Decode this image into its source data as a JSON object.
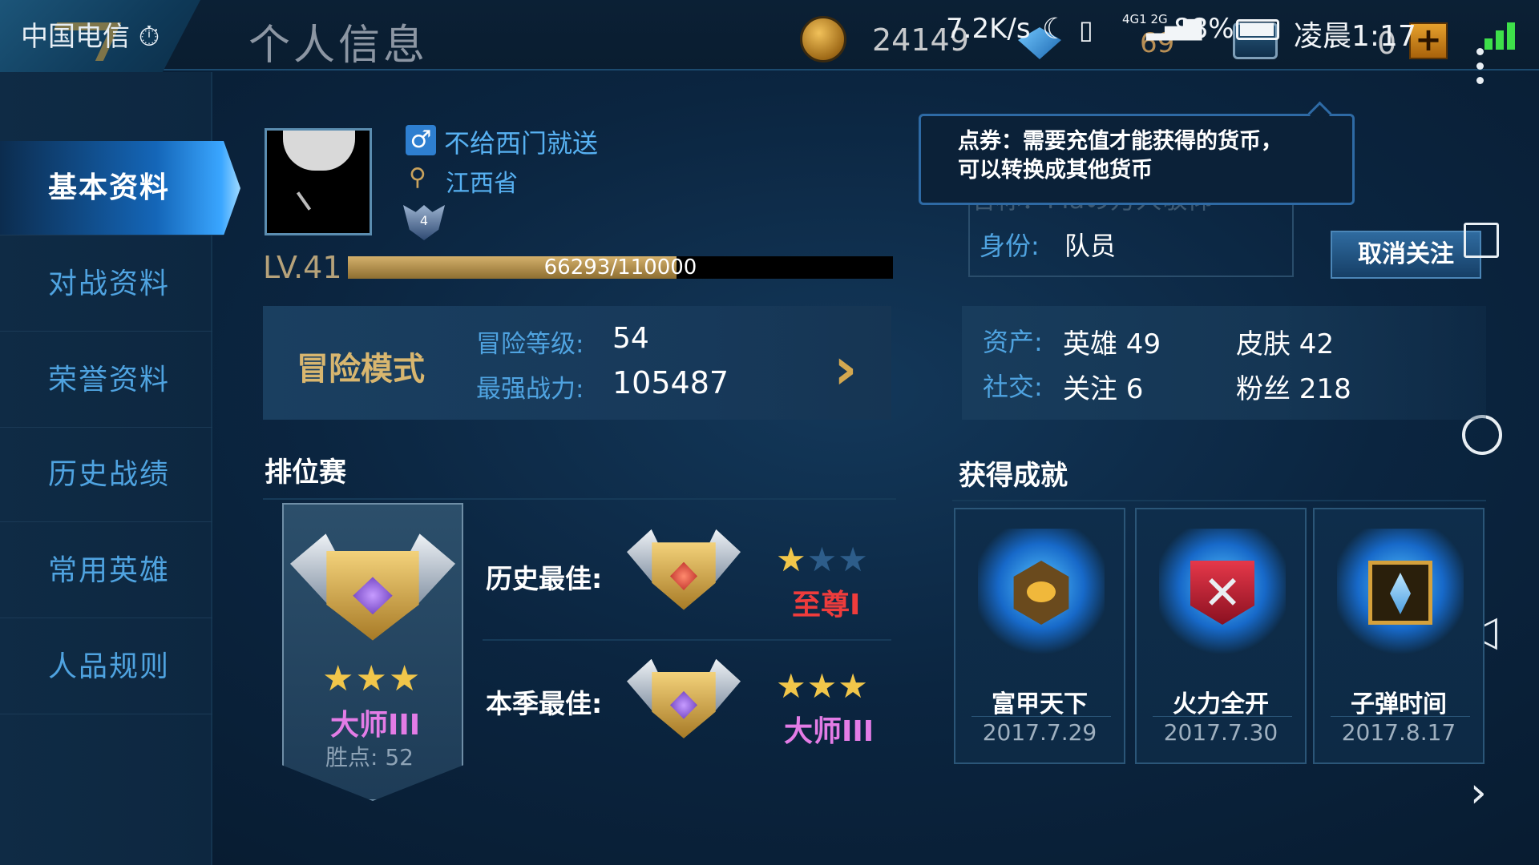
{
  "status_bar": {
    "carrier": "中国电信 ⏱",
    "net_speed": "7.2K/s",
    "net_type": "4G1 2G",
    "battery_pct": "88%",
    "time": "凌晨1:17"
  },
  "header": {
    "title": "个人信息",
    "gold": "24149",
    "diamonds": "69",
    "vouchers": "0",
    "plus": "+"
  },
  "sidebar": {
    "items": [
      {
        "label": "基本资料",
        "active": true
      },
      {
        "label": "对战资料"
      },
      {
        "label": "荣誉资料"
      },
      {
        "label": "历史战绩"
      },
      {
        "label": "常用英雄"
      },
      {
        "label": "人品规则"
      }
    ]
  },
  "profile": {
    "gender_symbol": "♂",
    "name": "不给西门就送",
    "location": "江西省",
    "badge_level": "4",
    "level": "LV.41",
    "xp_text": "66293/110000",
    "xp_fraction": 0.603
  },
  "adventure": {
    "title": "冒险模式",
    "level_label": "冒险等级:",
    "level_value": "54",
    "power_label": "最强战力:",
    "power_value": "105487",
    "arrow": "›"
  },
  "tooltip": {
    "line1": "点券：需要充值才能获得的货币，",
    "line2": "可以转换成其他货币"
  },
  "team": {
    "name_row": "名称：Maの万人敬仰",
    "identity_label": "身份:",
    "identity_value": "队员",
    "unfollow_label": "取消关注"
  },
  "assets": {
    "assets_label": "资产:",
    "heroes": "英雄 49",
    "skins": "皮肤 42",
    "social_label": "社交:",
    "follow": "关注 6",
    "fans": "粉丝 218"
  },
  "ranked": {
    "title": "排位赛",
    "current_stars": "★★★",
    "current_tier": "大师III",
    "points": "胜点: 52",
    "history_label": "历史最佳:",
    "history_stars_on": "★",
    "history_stars_off": "★★",
    "history_tier": "至尊I",
    "season_label": "本季最佳:",
    "season_stars": "★★★",
    "season_tier": "大师III"
  },
  "achievements": {
    "title": "获得成就",
    "items": [
      {
        "name": "富甲天下",
        "date": "2017.7.29"
      },
      {
        "name": "火力全开",
        "date": "2017.7.30"
      },
      {
        "name": "子弹时间",
        "date": "2017.8.17"
      }
    ]
  },
  "nav": {
    "back": "◁",
    "next": "›"
  }
}
